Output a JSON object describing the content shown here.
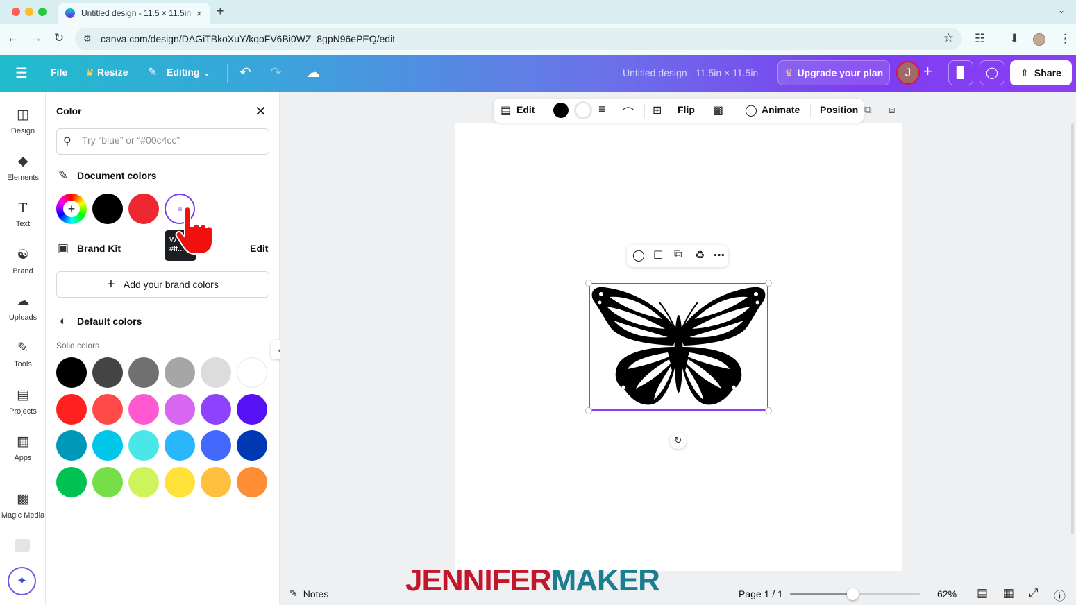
{
  "browser": {
    "tab_title": "Untitled design - 11.5 × 11.5in",
    "tab_close": "×",
    "new_tab": "+",
    "url": "canva.com/design/DAGiTBkoXuY/kqoFV6Bi0WZ_8gpN96ePEQ/edit",
    "lights": [
      "#ff5f57",
      "#febc2e",
      "#28c840"
    ]
  },
  "header": {
    "file": "File",
    "resize": "Resize",
    "editing": "Editing",
    "doc_title": "Untitled design - 11.5in × 11.5in",
    "upgrade": "Upgrade your plan",
    "avatar_initial": "J",
    "share": "Share"
  },
  "rail": {
    "items": [
      {
        "label": "Design",
        "icon": "design-icon"
      },
      {
        "label": "Elements",
        "icon": "elements-icon"
      },
      {
        "label": "Text",
        "icon": "text-icon"
      },
      {
        "label": "Brand",
        "icon": "brand-icon"
      },
      {
        "label": "Uploads",
        "icon": "uploads-icon"
      },
      {
        "label": "Tools",
        "icon": "tools-icon"
      },
      {
        "label": "Projects",
        "icon": "projects-icon"
      },
      {
        "label": "Apps",
        "icon": "apps-icon"
      },
      {
        "label": "Magic Media",
        "icon": "magic-media-icon"
      }
    ]
  },
  "panel": {
    "title": "Color",
    "search_placeholder": "Try “blue” or “#00c4cc”",
    "document_colors": {
      "label": "Document colors",
      "swatches": [
        "#000000",
        "#ee2830"
      ]
    },
    "tooltip": "W\n#ff...",
    "brand_kit": {
      "label": "Brand Kit",
      "edit": "Edit"
    },
    "add_brand": "Add your brand colors",
    "default_colors": "Default colors",
    "solid_label": "Solid colors",
    "solid_colors": [
      [
        "#000000",
        "#444444",
        "#707070",
        "#a6a6a6",
        "#dcdcdc",
        "#ffffff"
      ],
      [
        "#ff2020",
        "#ff4a4a",
        "#ff58d1",
        "#d866f0",
        "#8d43fb",
        "#5612f5"
      ],
      [
        "#0098b8",
        "#00c6e8",
        "#4ae7e8",
        "#29b6fb",
        "#4268fc",
        "#0039b4"
      ],
      [
        "#00c253",
        "#76de46",
        "#cef45c",
        "#ffe13a",
        "#ffc13d",
        "#ff8d35"
      ]
    ]
  },
  "toolbar": {
    "edit": "Edit",
    "flip": "Flip",
    "animate": "Animate",
    "position": "Position"
  },
  "bottombar": {
    "notes": "Notes",
    "page": "Page 1 / 1",
    "zoom": "62%",
    "zoom_fraction": 0.48
  },
  "watermark": {
    "part1": "JENNIFER",
    "part2": "MAKER"
  }
}
